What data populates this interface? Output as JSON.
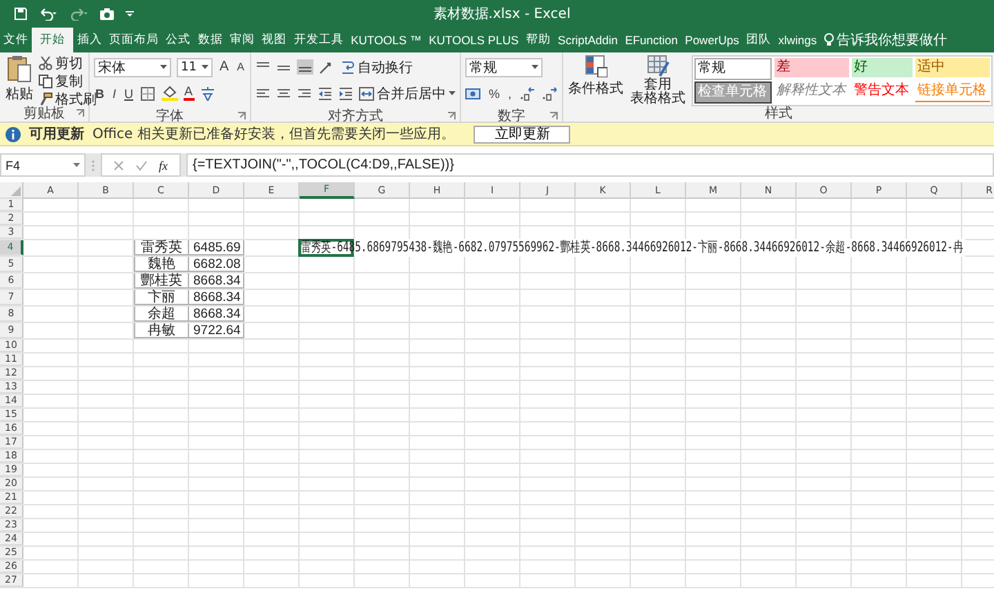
{
  "title_bar": {
    "title": "素材数据.xlsx  -  Excel"
  },
  "tabs": [
    {
      "label": "文件",
      "selected": false
    },
    {
      "label": "开始",
      "selected": true
    },
    {
      "label": "插入",
      "selected": false
    },
    {
      "label": "页面布局",
      "selected": false
    },
    {
      "label": "公式",
      "selected": false
    },
    {
      "label": "数据",
      "selected": false
    },
    {
      "label": "审阅",
      "selected": false
    },
    {
      "label": "视图",
      "selected": false
    },
    {
      "label": "开发工具",
      "selected": false
    },
    {
      "label": "KUTOOLS ™",
      "selected": false
    },
    {
      "label": "KUTOOLS PLUS",
      "selected": false
    },
    {
      "label": "帮助",
      "selected": false
    },
    {
      "label": "ScriptAddin",
      "selected": false
    },
    {
      "label": "EFunction",
      "selected": false
    },
    {
      "label": "PowerUps",
      "selected": false
    },
    {
      "label": "团队",
      "selected": false
    },
    {
      "label": "xlwings",
      "selected": false
    }
  ],
  "tell_me": "告诉我你想要做什",
  "ribbon": {
    "clipboard": {
      "label": "剪贴板",
      "paste": "粘贴",
      "cut": "剪切",
      "copy": "复制",
      "format_painter": "格式刷"
    },
    "font": {
      "label": "字体",
      "font_name": "宋体",
      "font_size": "11",
      "grow_font": "A",
      "shrink_font": "A",
      "bold": "B",
      "italic": "I",
      "underline": "U",
      "font_color": "A"
    },
    "alignment": {
      "label": "对齐方式",
      "wrap_text": "自动换行",
      "merge_center": "合并后居中"
    },
    "number": {
      "label": "数字",
      "format": "常规",
      "percent": "%",
      "comma": ","
    },
    "styles": {
      "label": "样式",
      "conditional_formatting": "条件格式",
      "format_as_table": [
        "套用",
        "表格格式"
      ],
      "cell_styles": [
        {
          "label": "常规",
          "kind": "normal"
        },
        {
          "label": "差",
          "kind": "bad"
        },
        {
          "label": "好",
          "kind": "good"
        },
        {
          "label": "适中",
          "kind": "neutral"
        },
        {
          "label": "检查单元格",
          "kind": "check"
        },
        {
          "label": "解释性文本",
          "kind": "explanatory"
        },
        {
          "label": "警告文本",
          "kind": "warning"
        },
        {
          "label": "链接单元格",
          "kind": "linked"
        }
      ]
    }
  },
  "info_bar": {
    "title": "可用更新",
    "message": "Office 相关更新已准备好安装，但首先需要关闭一些应用。",
    "button": "立即更新"
  },
  "formula_bar": {
    "name_box": "F4",
    "function_label": "fx",
    "formula": "{=TEXTJOIN(\"-\",,TOCOL(C4:D9,,FALSE))}"
  },
  "sheet": {
    "columns": [
      {
        "label": "A",
        "selected": false
      },
      {
        "label": "B",
        "selected": false
      },
      {
        "label": "C",
        "selected": false
      },
      {
        "label": "D",
        "selected": false
      },
      {
        "label": "E",
        "selected": false
      },
      {
        "label": "F",
        "selected": true
      },
      {
        "label": "G",
        "selected": false
      },
      {
        "label": "H",
        "selected": false
      },
      {
        "label": "I",
        "selected": false
      },
      {
        "label": "J",
        "selected": false
      },
      {
        "label": "K",
        "selected": false
      },
      {
        "label": "L",
        "selected": false
      },
      {
        "label": "M",
        "selected": false
      },
      {
        "label": "N",
        "selected": false
      },
      {
        "label": "O",
        "selected": false
      },
      {
        "label": "P",
        "selected": false
      },
      {
        "label": "Q",
        "selected": false
      },
      {
        "label": "R",
        "selected": false
      }
    ],
    "rows": [
      {
        "label": "1",
        "selected": false
      },
      {
        "label": "2",
        "selected": false
      },
      {
        "label": "3",
        "selected": false
      },
      {
        "label": "4",
        "selected": true
      },
      {
        "label": "5",
        "selected": false
      },
      {
        "label": "6",
        "selected": false
      },
      {
        "label": "7",
        "selected": false
      },
      {
        "label": "8",
        "selected": false
      },
      {
        "label": "9",
        "selected": false
      },
      {
        "label": "10",
        "selected": false
      },
      {
        "label": "11",
        "selected": false
      },
      {
        "label": "12",
        "selected": false
      },
      {
        "label": "13",
        "selected": false
      },
      {
        "label": "14",
        "selected": false
      },
      {
        "label": "15",
        "selected": false
      },
      {
        "label": "16",
        "selected": false
      },
      {
        "label": "17",
        "selected": false
      },
      {
        "label": "18",
        "selected": false
      },
      {
        "label": "19",
        "selected": false
      },
      {
        "label": "20",
        "selected": false
      },
      {
        "label": "21",
        "selected": false
      },
      {
        "label": "22",
        "selected": false
      },
      {
        "label": "23",
        "selected": false
      },
      {
        "label": "24",
        "selected": false
      },
      {
        "label": "25",
        "selected": false
      },
      {
        "label": "26",
        "selected": false
      },
      {
        "label": "27",
        "selected": false
      }
    ],
    "data_rows": [
      [
        "雷秀英",
        "6485.69"
      ],
      [
        "魏艳",
        "6682.08"
      ],
      [
        "酆桂英",
        "8668.34"
      ],
      [
        "卞丽",
        "8668.34"
      ],
      [
        "余超",
        "8668.34"
      ],
      [
        "冉敏",
        "9722.64"
      ]
    ],
    "active_cell": {
      "text": "雷秀英-6485.6869795438-魏艳-6682.07975569962-酆桂英-8668.34466926012-卞丽-8668.34466926012-余超-8668.34466926012-冉"
    }
  }
}
